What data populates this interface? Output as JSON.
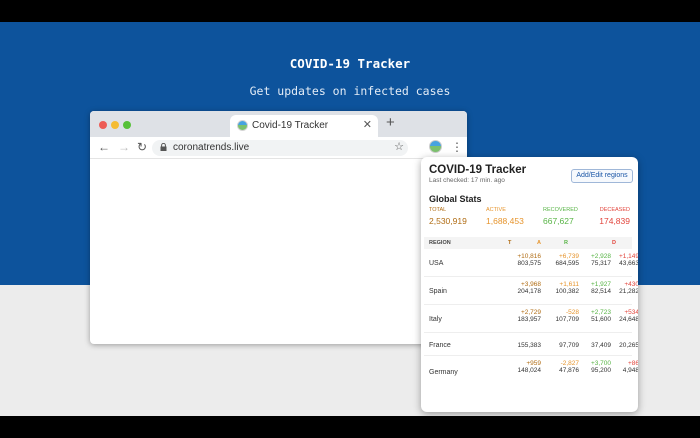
{
  "hero": {
    "title": "COVID-19 Tracker",
    "subtitle": "Get updates on infected cases"
  },
  "browser": {
    "tab_title": "Covid-19 Tracker",
    "url": "coronatrends.live",
    "icons": [
      "back-arrow-icon",
      "forward-arrow-icon",
      "reload-icon",
      "lock-icon",
      "star-icon",
      "kebab-menu-icon",
      "tab-close-icon",
      "new-tab-icon"
    ]
  },
  "popup": {
    "title": "COVID-19 Tracker",
    "last_checked": "Last checked: 17 min. ago",
    "add_button": "Add/Edit regions",
    "global_title": "Global Stats",
    "global": [
      {
        "label": "TOTAL",
        "value": "2,530,919",
        "color": "#b06c13"
      },
      {
        "label": "ACTIVE",
        "value": "1,688,453",
        "color": "#e6942c"
      },
      {
        "label": "RECOVERED",
        "value": "667,627",
        "color": "#58b446"
      },
      {
        "label": "DECEASED",
        "value": "174,839",
        "color": "#e2453c"
      }
    ],
    "columns": [
      "REGION",
      "T",
      "A",
      "R",
      "D"
    ],
    "rows": [
      {
        "region": "USA",
        "cells": [
          [
            "+10,816",
            "803,575"
          ],
          [
            "+6,739",
            "684,595"
          ],
          [
            "+2,928",
            "75,317"
          ],
          [
            "+1,149",
            "43,663"
          ]
        ]
      },
      {
        "region": "Spain",
        "cells": [
          [
            "+3,968",
            "204,178"
          ],
          [
            "+1,611",
            "100,382"
          ],
          [
            "+1,927",
            "82,514"
          ],
          [
            "+430",
            "21,282"
          ]
        ]
      },
      {
        "region": "Italy",
        "cells": [
          [
            "+2,729",
            "183,957"
          ],
          [
            "-528",
            "107,709"
          ],
          [
            "+2,723",
            "51,600"
          ],
          [
            "+534",
            "24,648"
          ]
        ]
      },
      {
        "region": "France",
        "cells": [
          [
            "",
            "155,383"
          ],
          [
            "",
            "97,709"
          ],
          [
            "",
            "37,409"
          ],
          [
            "",
            "20,265"
          ]
        ]
      },
      {
        "region": "Germany",
        "cells": [
          [
            "+959",
            "148,024"
          ],
          [
            "-2,827",
            "47,876"
          ],
          [
            "+3,700",
            "95,200"
          ],
          [
            "+86",
            "4,948"
          ]
        ]
      }
    ]
  }
}
